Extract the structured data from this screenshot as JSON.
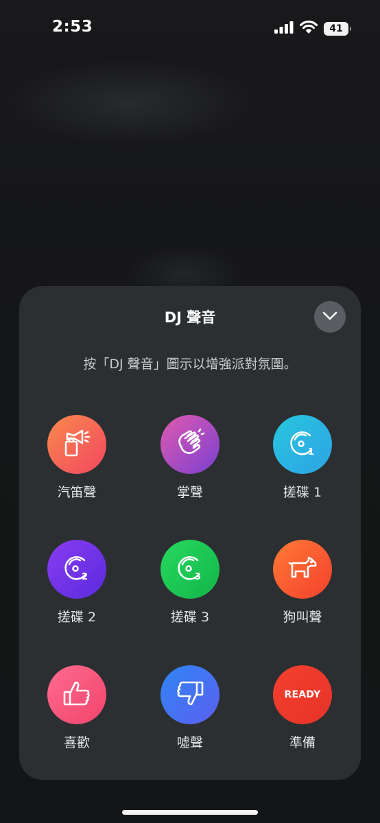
{
  "status_bar": {
    "time": "2:53",
    "battery_level": "41",
    "icons": [
      "cellular-signal-icon",
      "wifi-icon",
      "battery-icon"
    ]
  },
  "sheet": {
    "title": "DJ 聲音",
    "collapse_icon": "chevron-down-icon",
    "subtitle": "按「DJ 聲音」圖示以增強派對氛圍。",
    "sounds": [
      {
        "label": "汽笛聲",
        "icon": "air-horn-icon",
        "color": "#f4625a"
      },
      {
        "label": "掌聲",
        "icon": "clapping-hands-icon",
        "color": "#b24bbf"
      },
      {
        "label": "搓碟 1",
        "icon": "scratch-1-icon",
        "color": "#2bb8e2"
      },
      {
        "label": "搓碟 2",
        "icon": "scratch-2-icon",
        "color": "#7434ea"
      },
      {
        "label": "搓碟 3",
        "icon": "scratch-3-icon",
        "color": "#1ec957"
      },
      {
        "label": "狗叫聲",
        "icon": "dog-icon",
        "color": "#f95e31"
      },
      {
        "label": "喜歡",
        "icon": "thumbs-up-icon",
        "color": "#f7587d"
      },
      {
        "label": "噓聲",
        "icon": "thumbs-down-icon",
        "color": "#4473f2"
      },
      {
        "label": "準備",
        "icon": "ready-icon",
        "icon_text": "READY",
        "color": "#ed3a2b"
      }
    ]
  }
}
